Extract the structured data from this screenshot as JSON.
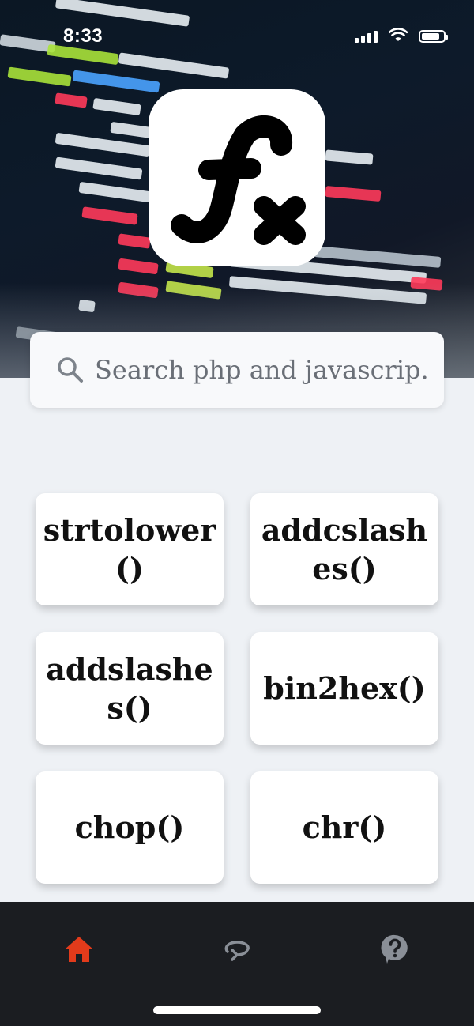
{
  "status_bar": {
    "time": "8:33"
  },
  "app": {
    "logo_icon": "function-fx-icon"
  },
  "search": {
    "placeholder": "Search php and javascrip..."
  },
  "functions": [
    {
      "label": "strtolower()"
    },
    {
      "label": "addcslashes()"
    },
    {
      "label": "addslashes()"
    },
    {
      "label": "bin2hex()"
    },
    {
      "label": "chop()"
    },
    {
      "label": "chr()"
    }
  ],
  "nav": {
    "items": [
      {
        "icon": "home-icon",
        "active": true
      },
      {
        "icon": "rotate-icon",
        "active": false
      },
      {
        "icon": "help-icon",
        "active": false
      }
    ],
    "active_color": "#e23b1b",
    "inactive_color": "#8a8f97"
  }
}
